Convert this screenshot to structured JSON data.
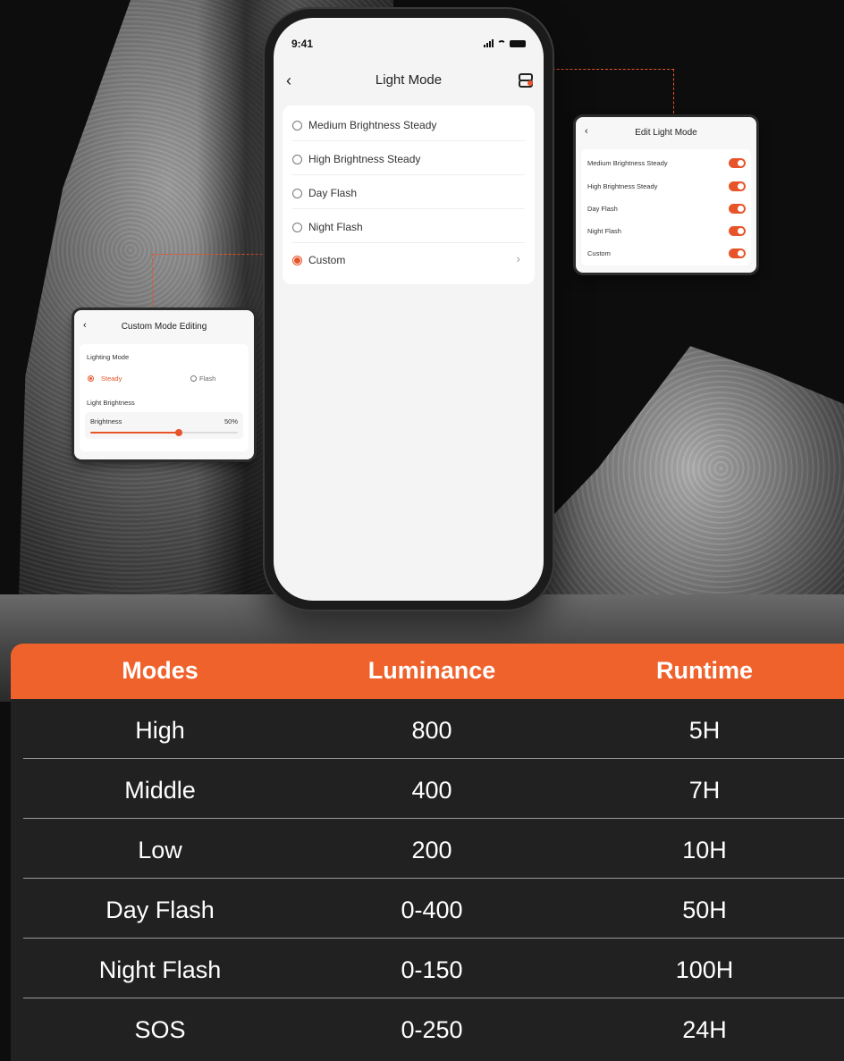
{
  "phone": {
    "status_time": "9:41",
    "title": "Light Mode",
    "back_icon": "chevron-left-icon",
    "edit_icon": "edit-list-icon",
    "modes": [
      {
        "label": "Medium Brightness Steady",
        "selected": false
      },
      {
        "label": "High Brightness Steady",
        "selected": false
      },
      {
        "label": "Day Flash",
        "selected": false
      },
      {
        "label": "Night Flash",
        "selected": false
      },
      {
        "label": "Custom",
        "selected": true
      }
    ]
  },
  "edit_card": {
    "title": "Edit Light Mode",
    "items": [
      {
        "label": "Medium Brightness Steady",
        "enabled": true
      },
      {
        "label": "High Brightness Steady",
        "enabled": true
      },
      {
        "label": "Day Flash",
        "enabled": true
      },
      {
        "label": "Night Flash",
        "enabled": true
      },
      {
        "label": "Custom",
        "enabled": true
      }
    ]
  },
  "custom_card": {
    "title": "Custom Mode Editing",
    "lighting_mode_label": "Lighting Mode",
    "option_steady": "Steady",
    "option_flash": "Flash",
    "selected_option": "Steady",
    "light_brightness_label": "Light Brightness",
    "brightness_label": "Brightness",
    "brightness_value": "50%",
    "brightness_fraction": 0.6
  },
  "table": {
    "headers": [
      "Modes",
      "Luminance",
      "Runtime"
    ],
    "rows": [
      [
        "High",
        "800",
        "5H"
      ],
      [
        "Middle",
        "400",
        "7H"
      ],
      [
        "Low",
        "200",
        "10H"
      ],
      [
        "Day Flash",
        "0-400",
        "50H"
      ],
      [
        "Night Flash",
        "0-150",
        "100H"
      ],
      [
        "SOS",
        "0-250",
        "24H"
      ]
    ]
  },
  "colors": {
    "accent": "#f0622c",
    "radio_accent": "#e8542a",
    "table_body": "#232323"
  }
}
